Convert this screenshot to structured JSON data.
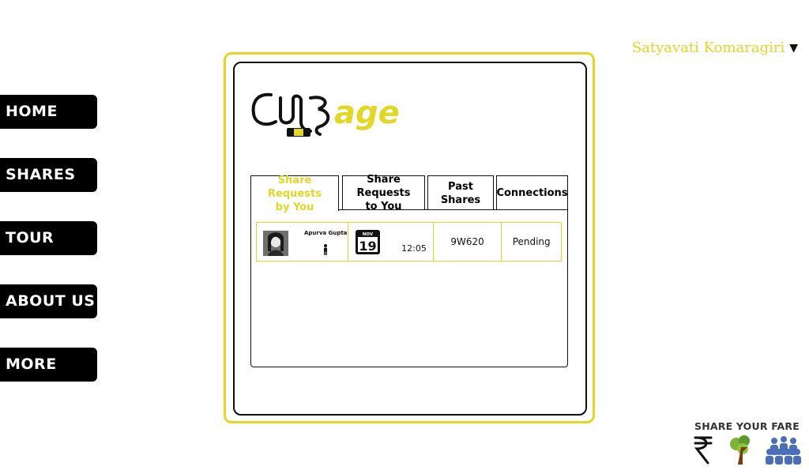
{
  "user": {
    "name": "Satyavati Komaragiri"
  },
  "nav": {
    "home": "HOME",
    "shares": "SHARES",
    "tour": "TOUR",
    "about": "ABOUT US",
    "more": "MORE"
  },
  "logo": {
    "text": "age"
  },
  "tabs": {
    "by_you_line1": "Share Requests",
    "by_you_line2": "by You",
    "to_you_line1": "Share Requests",
    "to_you_line2": "to You",
    "past": "Past Shares",
    "connections": "Connections"
  },
  "share_request": {
    "name": "Apurva Gupta",
    "month": "NOV",
    "day": "19",
    "time": "12:05",
    "flight": "9W620",
    "status": "Pending"
  },
  "footer": {
    "title": "SHARE YOUR FARE"
  },
  "colors": {
    "accent": "#e3d626",
    "nav_bg": "#000000",
    "border": "#111111"
  }
}
